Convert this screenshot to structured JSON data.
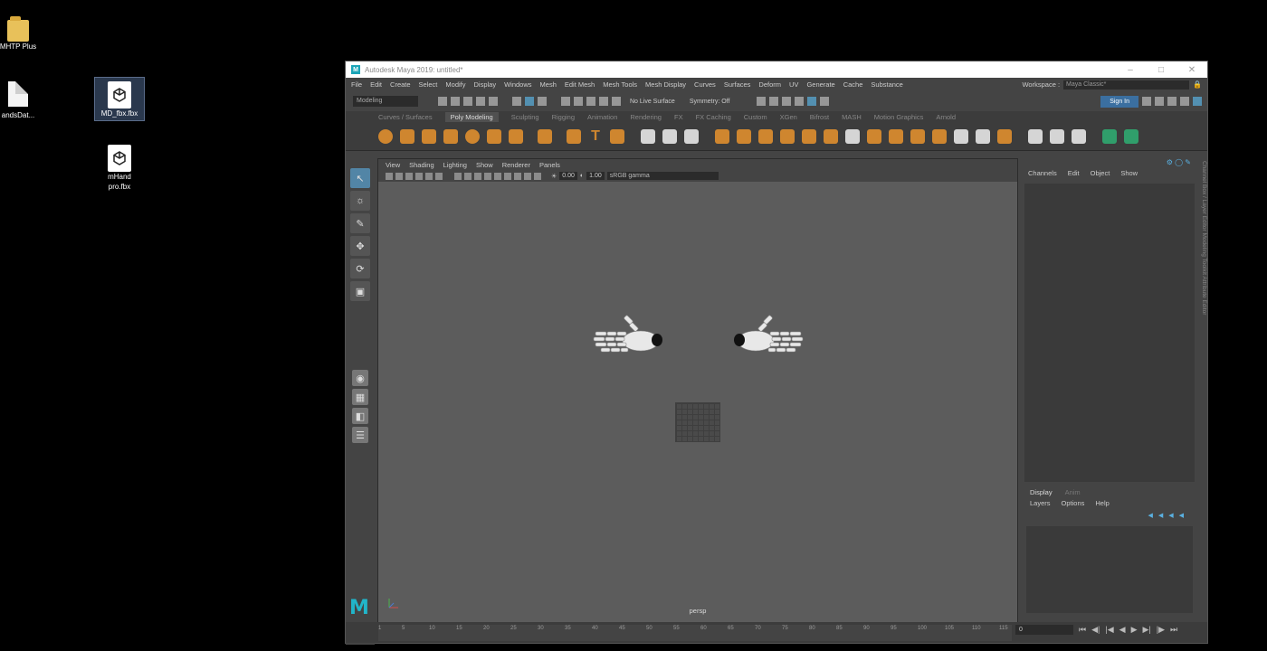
{
  "desktop": {
    "icons": [
      {
        "label": "MHTP Plus"
      },
      {
        "label": "andsDat..."
      },
      {
        "label": "MD_fbx.fbx"
      },
      {
        "label": "mHand\npro.fbx"
      }
    ]
  },
  "window": {
    "title": "Autodesk Maya 2019: untitled*",
    "menu": [
      "File",
      "Edit",
      "Create",
      "Select",
      "Modify",
      "Display",
      "Windows",
      "Mesh",
      "Edit Mesh",
      "Mesh Tools",
      "Mesh Display",
      "Curves",
      "Surfaces",
      "Deform",
      "UV",
      "Generate",
      "Cache",
      "Substance"
    ],
    "workspace_label": "Workspace :",
    "workspace_value": "Maya Classic*",
    "mode": "Modeling",
    "live_surface": "No Live Surface",
    "symmetry": "Symmetry: Off",
    "sign_in": "Sign In",
    "shelf_tabs": [
      "Curves / Surfaces",
      "Poly Modeling",
      "Sculpting",
      "Rigging",
      "Animation",
      "Rendering",
      "FX",
      "FX Caching",
      "Custom",
      "XGen",
      "Bifrost",
      "MASH",
      "Motion Graphics",
      "Arnold"
    ],
    "active_shelf_tab": "Poly Modeling"
  },
  "viewport": {
    "menu": [
      "View",
      "Shading",
      "Lighting",
      "Show",
      "Renderer",
      "Panels"
    ],
    "exposure": "0.00",
    "gamma_value": "1.00",
    "colorspace": "sRGB gamma",
    "camera": "persp"
  },
  "channel_box": {
    "menu": [
      "Channels",
      "Edit",
      "Object",
      "Show"
    ],
    "side_tabs": "Channel Box / Layer Editor    Modeling Toolkit    Attribute Editor"
  },
  "layer_editor": {
    "tabs": [
      "Display",
      "Anim"
    ],
    "menu": [
      "Layers",
      "Options",
      "Help"
    ]
  },
  "timeline": {
    "ticks": [
      "5",
      "10",
      "15",
      "20",
      "25",
      "30",
      "35",
      "40",
      "45",
      "50",
      "55",
      "60",
      "65",
      "70",
      "75",
      "80",
      "85",
      "90",
      "95",
      "100",
      "105",
      "110",
      "115",
      "12"
    ],
    "start": "1",
    "current_frame": "0"
  }
}
